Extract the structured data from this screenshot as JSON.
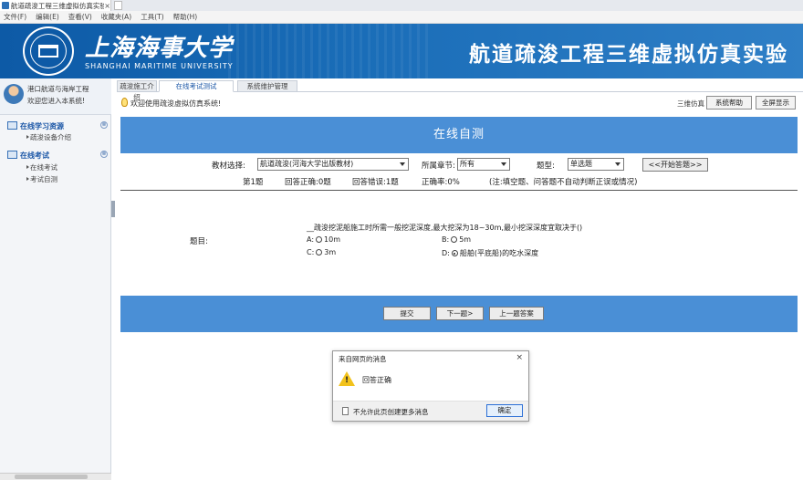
{
  "browser": {
    "tab_title": "航道疏浚工程三维虚拟仿真实验",
    "tab_close": "×",
    "menu": [
      "文件(F)",
      "编辑(E)",
      "查看(V)",
      "收藏夹(A)",
      "工具(T)",
      "帮助(H)"
    ]
  },
  "header": {
    "university_cn": "上海海事大学",
    "university_en": "SHANGHAI MARITIME UNIVERSITY",
    "system_title": "航道疏浚工程三维虚拟仿真实验"
  },
  "sidebar": {
    "user_line1": "港口航道与海岸工程",
    "user_line2": "欢迎您进入本系统!",
    "sections": [
      {
        "label": "在线学习资源",
        "toggle": "⊗",
        "items": [
          "疏浚设备介绍"
        ]
      },
      {
        "label": "在线考试",
        "toggle": "⊗",
        "items": [
          "在线考试",
          "考试自测"
        ]
      }
    ]
  },
  "tabs": [
    {
      "label": "疏浚施工介绍",
      "active": false
    },
    {
      "label": "在线考试测试",
      "active": true
    },
    {
      "label": "系统维护管理",
      "active": false
    }
  ],
  "notice": {
    "message": "欢迎使用疏浚虚拟仿真系统!",
    "user_label": "三维仿真",
    "btn_help": "系统帮助",
    "btn_fullscreen": "全屏显示"
  },
  "test": {
    "title": "在线自测",
    "filters": {
      "material_label": "教材选择:",
      "material_value": "航道疏浚(河海大学出版教材)",
      "chapter_label": "所属章节:",
      "chapter_value": "所有",
      "type_label": "题型:",
      "type_value": "单选题",
      "start_button": "<<开始答题>>"
    },
    "stats": {
      "current": "第1题",
      "correct": "回答正确:0题",
      "wrong": "回答错误:1题",
      "rate": "正确率:0%",
      "note": "(注:填空题、问答题不自动判断正误或情况)"
    },
    "question": {
      "label": "题目:",
      "text": "__疏浚挖泥船施工时所需一般挖泥深度,最大挖深为18~30m,最小挖深深度宜取决于()",
      "options": [
        {
          "key": "A:",
          "text": "10m",
          "selected": false
        },
        {
          "key": "B:",
          "text": "5m",
          "selected": false
        },
        {
          "key": "C:",
          "text": "3m",
          "selected": false
        },
        {
          "key": "D:",
          "text": "船舶(平底船)的吃水深度",
          "selected": true
        }
      ]
    },
    "actions": {
      "submit": "提交",
      "next": "下一题>",
      "review": "上一题答案"
    }
  },
  "dialog": {
    "title": "来自网页的消息",
    "close": "×",
    "message": "回答正确",
    "checkbox_label": "不允许此页创建更多消息",
    "ok": "确定"
  },
  "colors": {
    "banner": "#1a6db8",
    "bar": "#4a8fd6",
    "warning": "#f2c21b"
  }
}
